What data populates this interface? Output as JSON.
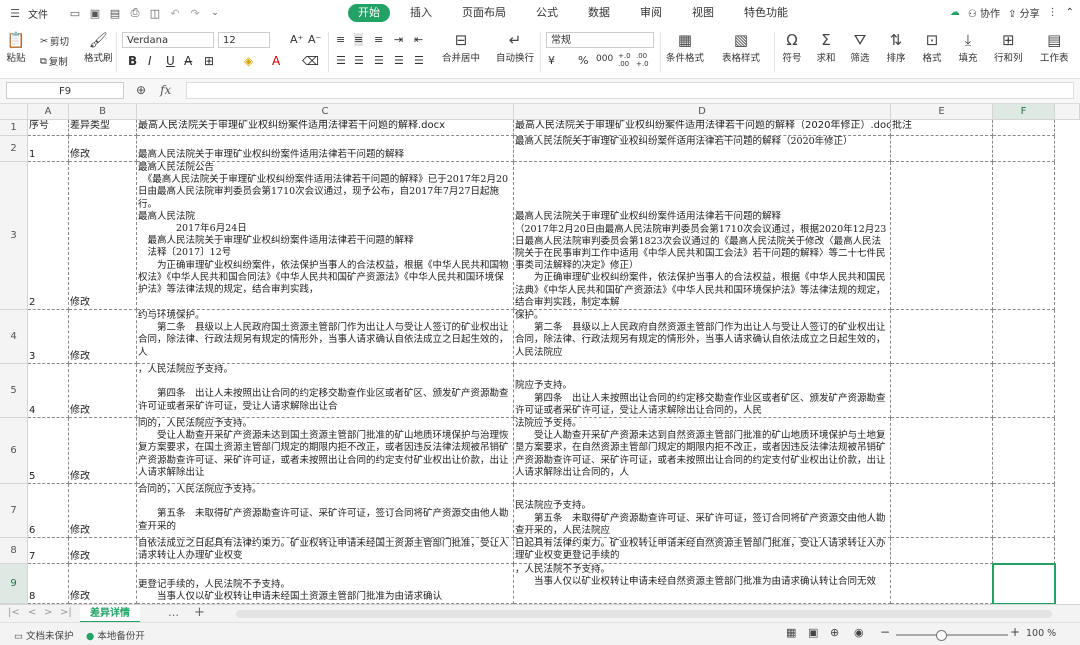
{
  "menubar": {
    "file_label": "文件",
    "tabs": [
      "开始",
      "插入",
      "页面布局",
      "公式",
      "数据",
      "审阅",
      "视图",
      "特色功能"
    ],
    "active_tab": "开始",
    "collab_label": "协作",
    "share_label": "分享"
  },
  "ribbon": {
    "paste_label": "粘贴",
    "cut_label": "剪切",
    "copy_label": "复制",
    "format_painter_label": "格式刷",
    "font_name": "Verdana",
    "font_size": "12",
    "merge_label": "合并居中",
    "wrap_label": "自动换行",
    "number_format": "常规",
    "cond_format_label": "条件格式",
    "table_style_label": "表格样式",
    "symbol_label": "符号",
    "sum_label": "求和",
    "filter_label": "筛选",
    "sort_label": "排序",
    "format_label": "格式",
    "fill_label": "填充",
    "rowcol_label": "行和列",
    "worksheet_label": "工作表",
    "percent": "%",
    "thousands": "000",
    "dec_inc": "+.0 .00",
    "dec_dec": ".00 +.0",
    "currency": "¥"
  },
  "formula_bar": {
    "name_box": "F9",
    "fx_label": "fx",
    "value": ""
  },
  "columns": [
    "A",
    "B",
    "C",
    "D",
    "E",
    "F"
  ],
  "selected_column": "F",
  "rows": [
    {
      "num": "1",
      "a": "序号",
      "b": "差异类型",
      "c": "最高人民法院关于审理矿业权纠纷案件适用法律若干问题的解释.docx",
      "d": "最高人民法院关于审理矿业权纠纷案件适用法律若干问题的解释（2020年修正）.docx",
      "e": "批注"
    },
    {
      "num": "2",
      "a": "1",
      "b": "修改",
      "c": "最高人民法院关于审理矿业权纠纷案件适用法律若干问题的解释",
      "d": "最高人民法院关于审理矿业权纠纷案件适用法律若干问题的解释（2020年修正）",
      "e": ""
    },
    {
      "num": "3",
      "a": "2",
      "b": "修改",
      "c": "最高人民法院公告\n　《最高人民法院关于审理矿业权纠纷案件适用法律若干问题的解释》已于2017年2月20日由最高人民法院审判委员会第1710次会议通过，现予公布，自2017年7月27日起施行。\n最高人民法院\n　　　　2017年6月24日\n　最高人民法院关于审理矿业权纠纷案件适用法律若干问题的解释\n　法释〔2017〕12号\n　　为正确审理矿业权纠纷案件，依法保护当事人的合法权益，根据《中华人民共和国物权法》《中华人民共和国合同法》《中华人民共和国矿产资源法》《中华人民共和国环境保护法》等法律法规的规定，结合审判实践，",
      "d": "最高人民法院关于审理矿业权纠纷案件适用法律若干问题的解释\n（2017年2月20日由最高人民法院审判委员会第1710次会议通过，根据2020年12月23日最高人民法院审判委员会第1823次会议通过的《最高人民法院关于修改〈最高人民法院关于在民事审判工作中适用《中华人民共和国工会法》若干问题的解释〉等二十七件民事类司法解释的决定》修正）\n　　为正确审理矿业权纠纷案件，依法保护当事人的合法权益，根据《中华人民共和国民法典》《中华人民共和国矿产资源法》《中华人民共和国环境保护法》等法律法规的规定，结合审判实践，制定本解",
      "e": ""
    },
    {
      "num": "4",
      "a": "3",
      "b": "修改",
      "c": "约与环境保护。\n　　第二条　县级以上人民政府国土资源主管部门作为出让人与受让人签订的矿业权出让合同，除法律、行政法规另有规定的情形外，当事人请求确认自依法成立之日起生效的，人",
      "d": "保护。\n　　第二条　县级以上人民政府自然资源主管部门作为出让人与受让人签订的矿业权出让合同，除法律、行政法规另有规定的情形外，当事人请求确认自依法成立之日起生效的，人民法院应",
      "e": ""
    },
    {
      "num": "5",
      "a": "4",
      "b": "修改",
      "c": "，人民法院应予支持。\n\n　　第四条　出让人未按照出让合同的约定移交勘查作业区或者矿区、颁发矿产资源勘查许可证或者采矿许可证，受让人请求解除出让合",
      "d": "院应予支持。\n　　第四条　出让人未按照出让合同的约定移交勘查作业区或者矿区、颁发矿产资源勘查许可证或者采矿许可证，受让人请求解除出让合同的，人民",
      "e": ""
    },
    {
      "num": "6",
      "a": "5",
      "b": "修改",
      "c": "同的，人民法院应予支持。\n　　受让人勘查开采矿产资源未达到国土资源主管部门批准的矿山地质环境保护与治理恢复方案要求，在国土资源主管部门规定的期限内拒不改正，或者因违反法律法规被吊销矿产资源勘查许可证、采矿许可证，或者未按照出让合同的约定支付矿业权出让价款，出让人请求解除出让",
      "d": "法院应予支持。\n　　受让人勘查开采矿产资源未达到自然资源主管部门批准的矿山地质环境保护与土地复垦方案要求，在自然资源主管部门规定的期限内拒不改正，或者因违反法律法规被吊销矿产资源勘查许可证、采矿许可证，或者未按照出让合同的约定支付矿业权出让价款，出让人请求解除出让合同的，人",
      "e": ""
    },
    {
      "num": "7",
      "a": "6",
      "b": "修改",
      "c": "合同的，人民法院应予支持。\n\n　　第五条　未取得矿产资源勘查许可证、采矿许可证，签订合同将矿产资源交由他人勘查开采的",
      "d": "民法院应予支持。\n　　第五条　未取得矿产资源勘查许可证、采矿许可证，签订合同将矿产资源交由他人勘查开采的，人民法院应",
      "e": ""
    },
    {
      "num": "8",
      "a": "7",
      "b": "修改",
      "c": "自依法成立之日起具有法律约束力。矿业权转让申请未经国土资源主管部门批准，受让人请求转让人办理矿业权变",
      "d": "日起具有法律约束力。矿业权转让申请未经自然资源主管部门批准，受让人请求转让人办理矿业权变更登记手续的",
      "e": ""
    },
    {
      "num": "9",
      "a": "8",
      "b": "修改",
      "c": "更登记手续的，人民法院不予支持。\n　　当事人仅以矿业权转让申请未经国土资源主管部门批准为由请求确认",
      "d": "，人民法院不予支持。\n　　当事人仅以矿业权转让申请未经自然资源主管部门批准为由请求确认转让合同无效",
      "e": ""
    }
  ],
  "sheet_tabs": [
    "差异详情"
  ],
  "active_sheet": "差异详情",
  "status": {
    "protect_label": "文档未保护",
    "backup_label": "本地备份开",
    "zoom": "100 %"
  }
}
